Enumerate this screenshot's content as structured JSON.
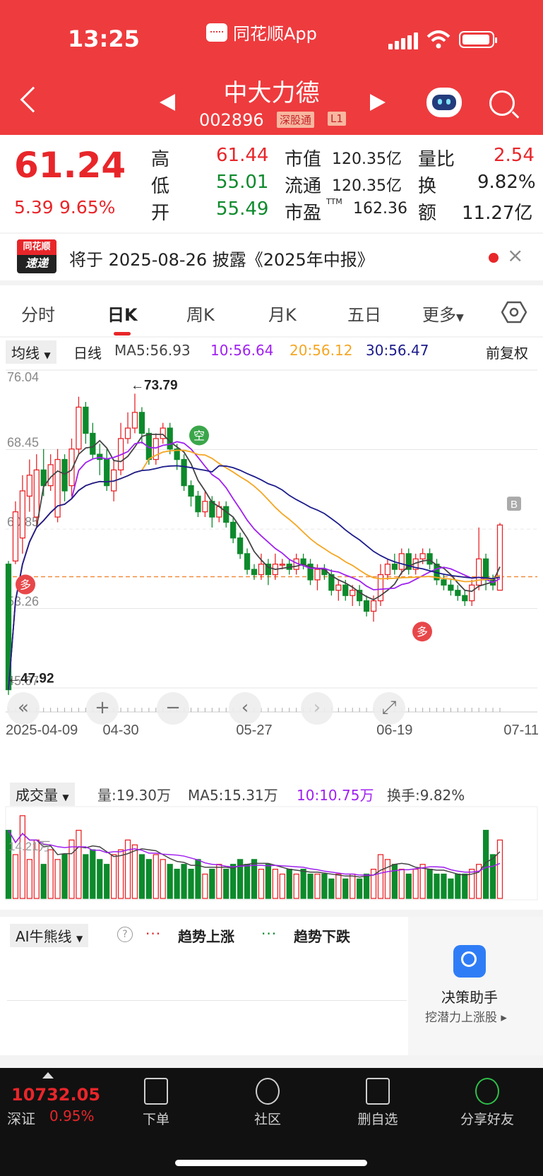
{
  "status_bar": {
    "time": "13:25",
    "app_name": "同花顺App"
  },
  "header": {
    "stock_name": "中大力德",
    "stock_code": "002896",
    "market_tag": "深股通",
    "level_tag": "L1"
  },
  "quote": {
    "price": "61.24",
    "change": "5.39",
    "change_pct": "9.65%",
    "high_label": "高",
    "high": "61.44",
    "low_label": "低",
    "low": "55.01",
    "open_label": "开",
    "open": "55.49",
    "mcap_label": "市值",
    "mcap": "120.35亿",
    "float_label": "流通",
    "float": "120.35亿",
    "pe_label": "市盈",
    "pe_sup": "TTM",
    "pe": "162.36",
    "vr_label": "量比",
    "vr": "2.54",
    "turn_label": "换",
    "turn": "9.82%",
    "amt_label": "额",
    "amt": "11.27亿"
  },
  "news": {
    "logo_top": "同花顺",
    "logo_bottom": "速递",
    "text": "将于 2025-08-26 披露《2025年中报》"
  },
  "tabs": [
    "分时",
    "日K",
    "周K",
    "月K",
    "五日",
    "更多"
  ],
  "active_tab": 1,
  "ma_bar": {
    "selector": "均线",
    "period": "日线",
    "ma5": "MA5:56.93",
    "ma10": "10:56.64",
    "ma20": "20:56.12",
    "ma30": "30:56.47",
    "adjust": "前复权"
  },
  "chart_data": {
    "type": "candlestick",
    "y_ticks": [
      "76.04",
      "68.45",
      "60.85",
      "53.26",
      "45.67"
    ],
    "x_ticks": [
      "2025-04-09",
      "04-30",
      "05-27",
      "06-19",
      "07-11"
    ],
    "max_label": "←73.79",
    "min_label": "←47.92",
    "markers": {
      "buy": "多",
      "sell": "空",
      "b": "B"
    },
    "colors": {
      "up": "#e8262a",
      "down": "#0d8a2c",
      "ma5": "#444444",
      "ma10": "#a020f0",
      "ma20": "#f5a623",
      "ma30": "#1c1c8c"
    },
    "candles": [
      [
        57.5,
        45.5,
        57.8,
        45.0
      ],
      [
        57.8,
        62.5,
        63.5,
        57.5
      ],
      [
        60.0,
        64.5,
        66.0,
        58.5
      ],
      [
        64.0,
        66.0,
        67.5,
        62.5
      ],
      [
        62.0,
        66.5,
        68.0,
        61.0
      ],
      [
        66.5,
        65.0,
        68.5,
        64.0
      ],
      [
        65.0,
        67.0,
        68.0,
        64.5
      ],
      [
        62.0,
        67.5,
        68.5,
        61.5
      ],
      [
        67.5,
        64.5,
        68.0,
        63.5
      ],
      [
        65.0,
        68.5,
        69.5,
        64.0
      ],
      [
        68.5,
        72.5,
        73.5,
        68.0
      ],
      [
        72.5,
        70.0,
        73.0,
        69.0
      ],
      [
        70.0,
        68.0,
        71.0,
        67.5
      ],
      [
        68.0,
        67.5,
        69.0,
        66.0
      ],
      [
        67.5,
        65.0,
        68.5,
        64.5
      ],
      [
        64.5,
        66.5,
        67.5,
        63.5
      ],
      [
        66.5,
        69.5,
        71.0,
        66.0
      ],
      [
        69.5,
        70.5,
        72.0,
        69.0
      ],
      [
        70.5,
        72.0,
        73.79,
        70.0
      ],
      [
        72.0,
        70.0,
        72.5,
        69.0
      ],
      [
        70.0,
        67.5,
        70.5,
        67.0
      ],
      [
        67.5,
        69.5,
        70.0,
        67.0
      ],
      [
        69.5,
        70.5,
        71.0,
        69.0
      ],
      [
        70.5,
        68.5,
        71.0,
        68.0
      ],
      [
        68.5,
        67.5,
        69.0,
        66.5
      ],
      [
        67.5,
        65.0,
        68.0,
        64.5
      ],
      [
        65.0,
        64.0,
        65.5,
        63.0
      ],
      [
        64.0,
        62.5,
        64.5,
        62.0
      ],
      [
        62.5,
        63.5,
        64.5,
        62.0
      ],
      [
        63.5,
        62.0,
        64.0,
        61.0
      ],
      [
        62.0,
        63.0,
        63.5,
        61.5
      ],
      [
        63.0,
        61.5,
        63.5,
        61.0
      ],
      [
        61.5,
        60.0,
        62.0,
        59.5
      ],
      [
        60.0,
        58.5,
        60.5,
        58.0
      ],
      [
        58.5,
        57.0,
        59.0,
        56.5
      ],
      [
        57.0,
        56.5,
        57.5,
        56.0
      ],
      [
        56.5,
        57.5,
        58.5,
        56.0
      ],
      [
        57.5,
        56.5,
        58.0,
        55.5
      ],
      [
        56.5,
        57.5,
        58.5,
        56.0
      ],
      [
        57.5,
        57.5,
        58.0,
        57.0
      ],
      [
        57.5,
        57.0,
        58.0,
        56.5
      ],
      [
        57.0,
        58.0,
        58.5,
        56.5
      ],
      [
        58.0,
        57.5,
        58.5,
        57.0
      ],
      [
        57.5,
        56.0,
        58.0,
        55.5
      ],
      [
        56.0,
        57.0,
        57.5,
        55.0
      ],
      [
        57.0,
        56.5,
        57.5,
        56.0
      ],
      [
        56.5,
        55.0,
        57.0,
        54.5
      ],
      [
        55.0,
        55.5,
        56.0,
        54.0
      ],
      [
        55.5,
        54.5,
        56.0,
        54.0
      ],
      [
        54.5,
        55.0,
        55.5,
        53.5
      ],
      [
        55.0,
        54.0,
        55.5,
        53.5
      ],
      [
        54.0,
        53.0,
        54.5,
        52.5
      ],
      [
        53.0,
        54.0,
        54.5,
        52.0
      ],
      [
        54.0,
        56.5,
        57.5,
        53.5
      ],
      [
        56.5,
        57.5,
        58.0,
        56.0
      ],
      [
        57.5,
        57.0,
        58.5,
        56.5
      ],
      [
        57.0,
        58.5,
        59.0,
        56.5
      ],
      [
        58.5,
        57.0,
        59.0,
        56.5
      ],
      [
        57.0,
        58.0,
        58.5,
        56.5
      ],
      [
        58.0,
        58.5,
        59.0,
        57.5
      ],
      [
        58.5,
        57.5,
        59.0,
        57.0
      ],
      [
        57.5,
        56.0,
        58.0,
        55.5
      ],
      [
        56.0,
        55.5,
        56.5,
        55.0
      ],
      [
        55.5,
        55.0,
        56.0,
        54.5
      ],
      [
        55.0,
        54.5,
        55.5,
        54.0
      ],
      [
        54.5,
        54.0,
        55.0,
        53.5
      ],
      [
        54.0,
        55.5,
        56.0,
        53.5
      ],
      [
        55.49,
        58.0,
        61.0,
        55.0
      ],
      [
        58.0,
        56.0,
        58.5,
        55.0
      ],
      [
        56.0,
        55.5,
        56.5,
        55.0
      ],
      [
        55.01,
        61.24,
        61.44,
        55.01
      ]
    ]
  },
  "controls": [
    "«",
    "+",
    "−",
    "‹",
    "›",
    "⤢"
  ],
  "volume": {
    "selector": "成交量",
    "vol": "量:19.30万",
    "ma5": "MA5:15.31万",
    "ma10": "10:10.75万",
    "turnover": "换手:9.82%",
    "scale": "14.21万"
  },
  "volume_data": [
    14,
    9,
    17,
    8,
    12,
    7,
    10,
    8,
    9,
    12,
    14,
    9,
    10,
    8,
    7,
    9,
    10,
    12,
    11,
    9,
    8,
    9,
    8,
    7,
    6,
    7,
    6,
    8,
    5,
    6,
    7,
    6,
    7,
    8,
    7,
    8,
    6,
    7,
    6,
    5,
    6,
    5,
    6,
    5,
    5,
    5,
    4,
    5,
    4,
    5,
    4,
    5,
    6,
    9,
    8,
    7,
    6,
    5,
    6,
    7,
    6,
    5,
    5,
    4,
    5,
    5,
    6,
    7,
    14,
    9,
    12
  ],
  "ai": {
    "selector": "AI牛熊线",
    "up": "趋势上涨",
    "down": "趋势下跌",
    "helper": "决策助手",
    "helper_sub": "挖潜力上涨股"
  },
  "bottom": {
    "index_value": "10732.05",
    "index_name": "深证",
    "index_pct": "0.95%",
    "items": [
      "下单",
      "社区",
      "删自选",
      "分享好友"
    ]
  }
}
